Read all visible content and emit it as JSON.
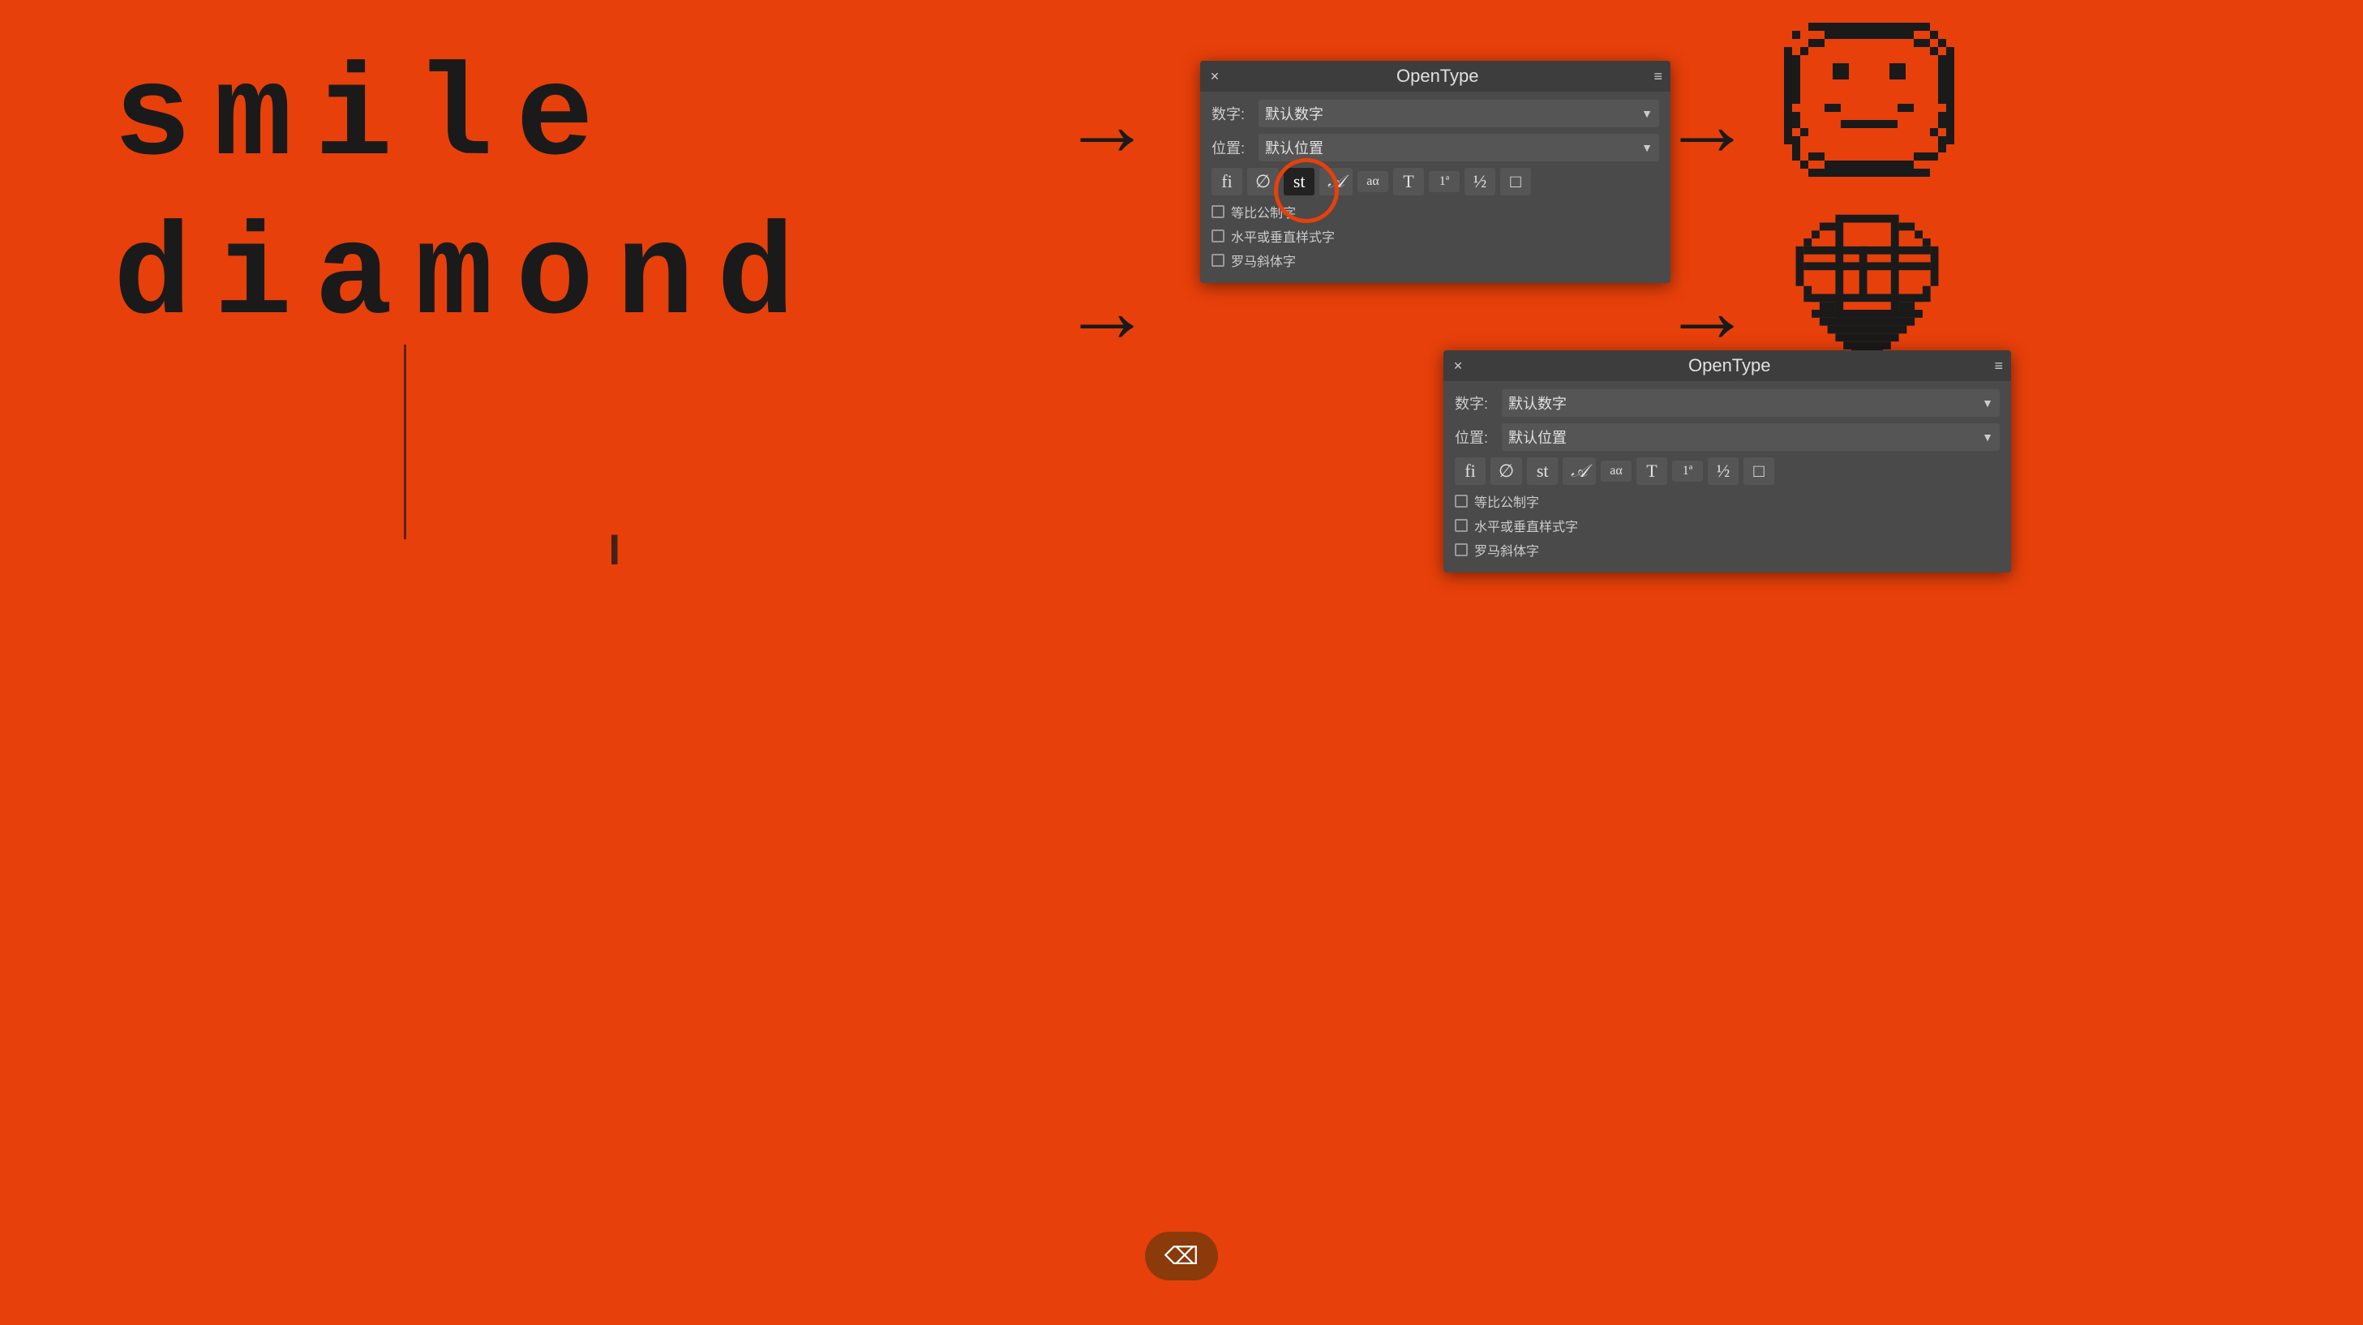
{
  "background_color": "#e8400a",
  "main_words": {
    "smile": "smile",
    "diamond": "diamond"
  },
  "arrows": [
    "→",
    "→",
    "→",
    "→"
  ],
  "opentype_panel_top": {
    "title": "OpenType",
    "close_btn": "✕",
    "menu_btn": "≡",
    "rows": [
      {
        "label": "数字:",
        "value": "默认数字"
      },
      {
        "label": "位置:",
        "value": "默认位置"
      }
    ],
    "typo_buttons": [
      "fi",
      "∅",
      "st",
      "A",
      "aα",
      "T",
      "1ª",
      "½",
      "□"
    ],
    "checkboxes": [
      "等比公制字",
      "水平或垂直样式字",
      "罗马斜体字"
    ],
    "highlighted_btn": "st"
  },
  "opentype_panel_bottom": {
    "title": "OpenType",
    "close_btn": "✕",
    "menu_btn": "≡",
    "rows": [
      {
        "label": "数字:",
        "value": "默认数字"
      },
      {
        "label": "位置:",
        "value": "默认位置"
      }
    ],
    "typo_buttons": [
      "fi",
      "∅",
      "st",
      "A",
      "aα",
      "T",
      "1ª",
      "½",
      "□"
    ],
    "checkboxes": [
      "等比公制字",
      "水平或垂直样式字",
      "罗马斜体字"
    ]
  },
  "bottom_button": {
    "icon": "⌫"
  },
  "pixel_icons": {
    "smiley": "☺",
    "diamond": "⬡"
  }
}
